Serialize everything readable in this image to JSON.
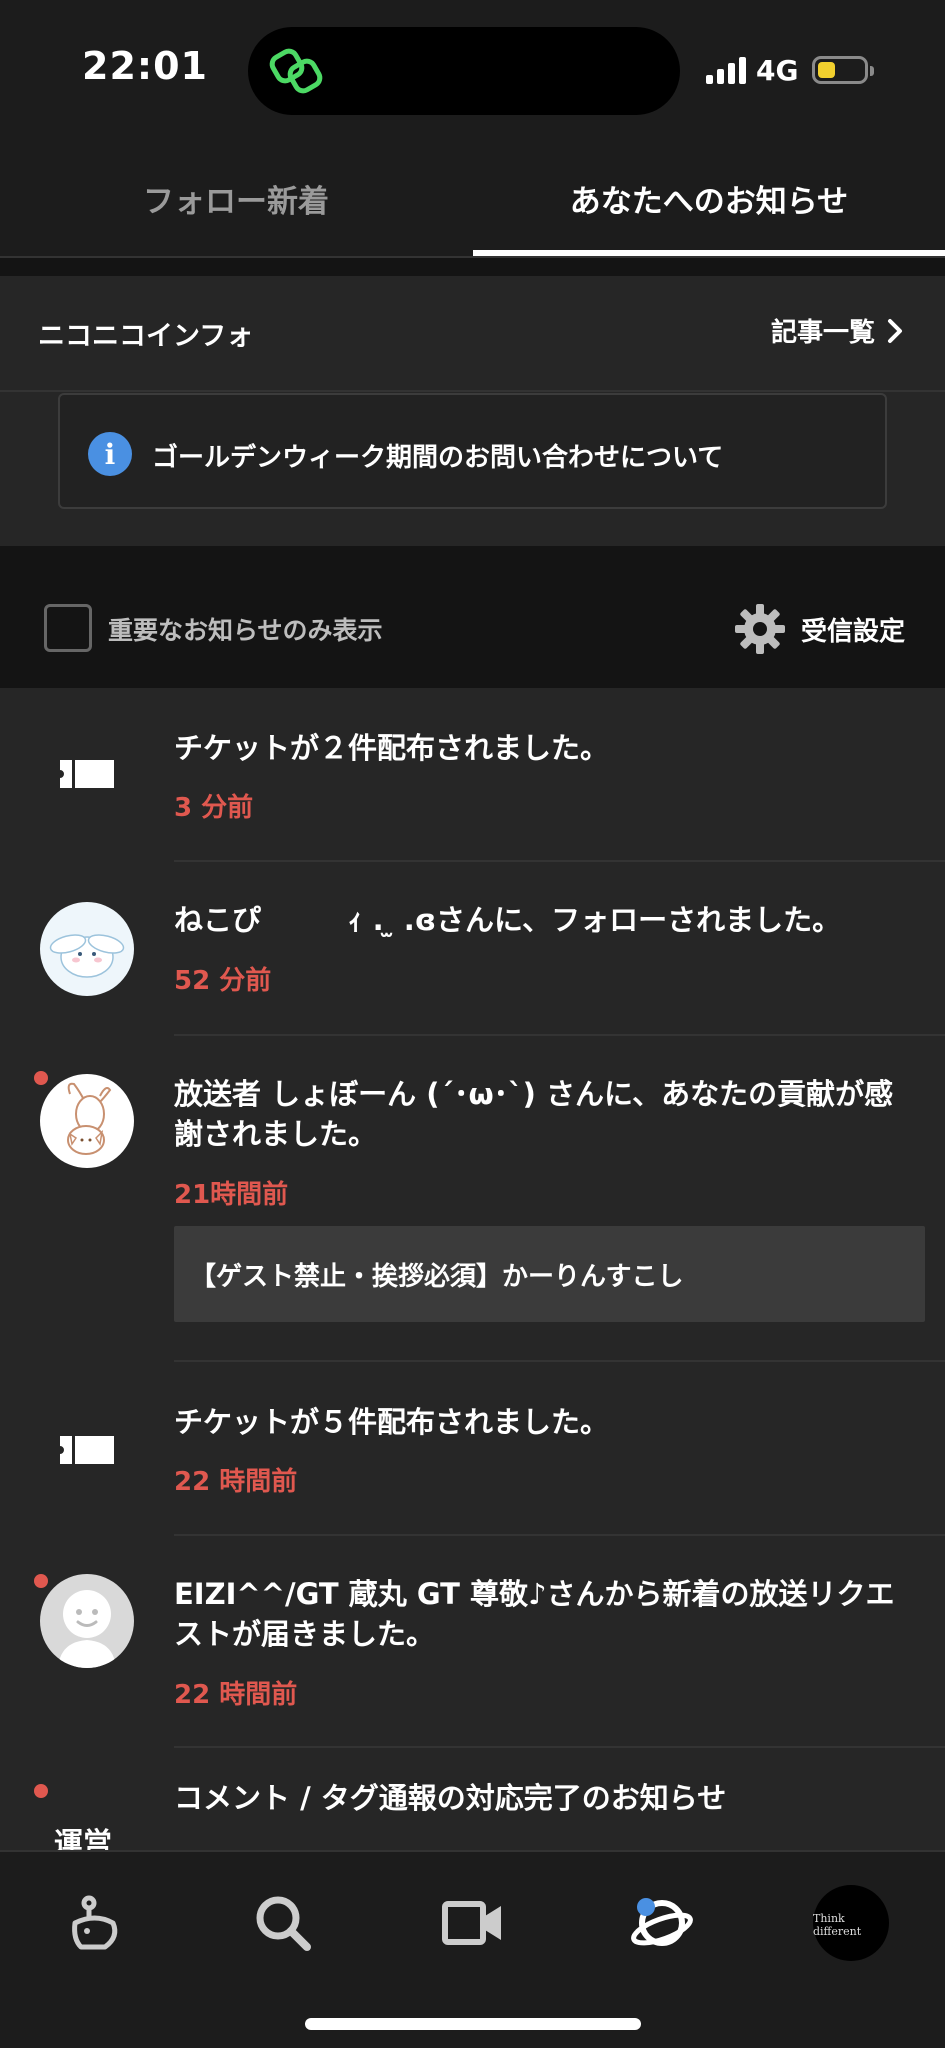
{
  "status_bar": {
    "time": "22:01",
    "network": "4G"
  },
  "tabs": [
    {
      "label": "フォロー新着",
      "active": false
    },
    {
      "label": "あなたへのお知らせ",
      "active": true
    }
  ],
  "info": {
    "title": "ニコニコインフォ",
    "more_label": "記事一覧",
    "notice": "ゴールデンウィーク期間のお問い合わせについて"
  },
  "filter": {
    "checkbox_label": "重要なお知らせのみ表示",
    "settings_label": "受信設定"
  },
  "notifications": [
    {
      "message": "チケットが２件配布されました。",
      "time": "3 分前"
    },
    {
      "message": "ねこぴ　　　ｨ .  ̫ .ɞさんに、フォローされました。",
      "time": "52 分前"
    },
    {
      "message": "放送者 しょぼーん (´･ω･`) さんに、あなたの貢献が感謝されました。",
      "time": "21時間前",
      "quote": "【ゲスト禁止・挨拶必須】かーりんすこし"
    },
    {
      "message": "チケットが５件配布されました。",
      "time": "22 時間前"
    },
    {
      "message": "EIZI^^/GT 蔵丸 GT 尊敬♪さんから新着の放送リクエストが届きました。",
      "time": "22 時間前"
    },
    {
      "badge": "運営",
      "message": "コメント / タグ通報の対応完了のお知らせ"
    }
  ],
  "bottom_nav": {
    "profile_caption": "Think different"
  },
  "colors": {
    "accent_red": "#e0584f",
    "info_blue": "#4a90e2",
    "background": "#1c1c1c"
  }
}
